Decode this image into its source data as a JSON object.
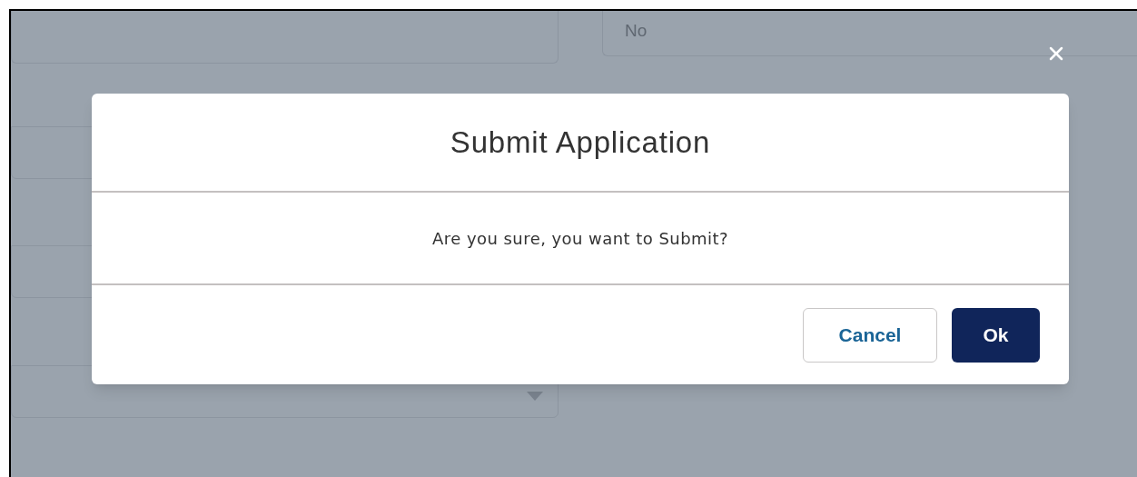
{
  "background_form": {
    "left_fields": [
      {
        "kind": "text"
      },
      {
        "kind": "text"
      },
      {
        "kind": "text"
      },
      {
        "kind": "select"
      }
    ],
    "right_field": {
      "value": "No"
    }
  },
  "dialog": {
    "title": "Submit Application",
    "message": "Are you sure, you want to Submit?",
    "buttons": [
      {
        "label": "Cancel",
        "kind": "secondary"
      },
      {
        "label": "Ok",
        "kind": "primary"
      }
    ]
  }
}
